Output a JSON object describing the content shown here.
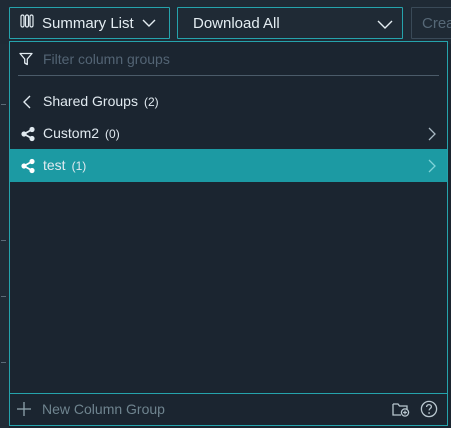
{
  "toolbar": {
    "summary_label": "Summary List",
    "download_label": "Download All",
    "create_label": "Crea",
    "icons": {
      "columns": "columns-icon",
      "chevron": "chevron-down-icon"
    }
  },
  "panel": {
    "filter_placeholder": "Filter column groups",
    "back_row": {
      "label": "Shared Groups",
      "count": "(2)"
    },
    "groups": [
      {
        "label": "Custom2",
        "count": "(0)",
        "selected": false
      },
      {
        "label": "test",
        "count": "(1)",
        "selected": true
      }
    ],
    "footer": {
      "new_group_label": "New Column Group"
    }
  },
  "colors": {
    "accent": "#25a3ac",
    "selected_row": "#1c9aa3",
    "background": "#1b2530",
    "text": "#e1eaf0",
    "muted": "#536474"
  }
}
